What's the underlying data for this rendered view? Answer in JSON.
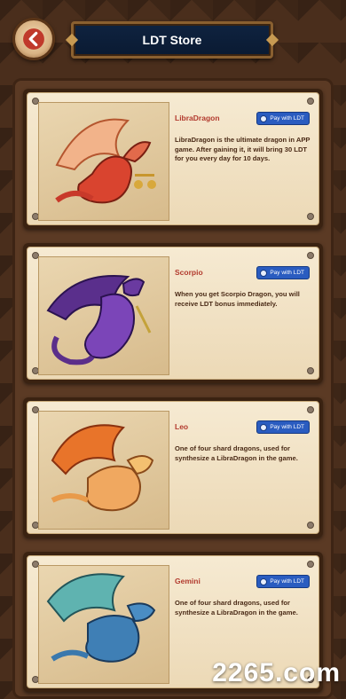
{
  "header": {
    "title": "LDT Store",
    "back_icon": "arrow-left-icon"
  },
  "cards": [
    {
      "name": "LibraDragon",
      "pay_label": "Pay with LDT",
      "description": "LibraDragon is the ultimate dragon in APP game. After gaining it, it will bring 30 LDT for you every day for 10 days.",
      "color": "#d9442f"
    },
    {
      "name": "Scorpio",
      "pay_label": "Pay with LDT",
      "description": "When you get Scorpio Dragon, you will receive LDT bonus immediately.",
      "color": "#6a3aa0"
    },
    {
      "name": "Leo",
      "pay_label": "Pay with LDT",
      "description": "One of four shard dragons, used for synthesize a LibraDragon in the game.",
      "color": "#e8742a"
    },
    {
      "name": "Gemini",
      "pay_label": "Pay with LDT",
      "description": "One of four shard dragons, used for synthesize a LibraDragon in the game.",
      "color": "#3f7fb5"
    }
  ],
  "watermark": "2265.com"
}
